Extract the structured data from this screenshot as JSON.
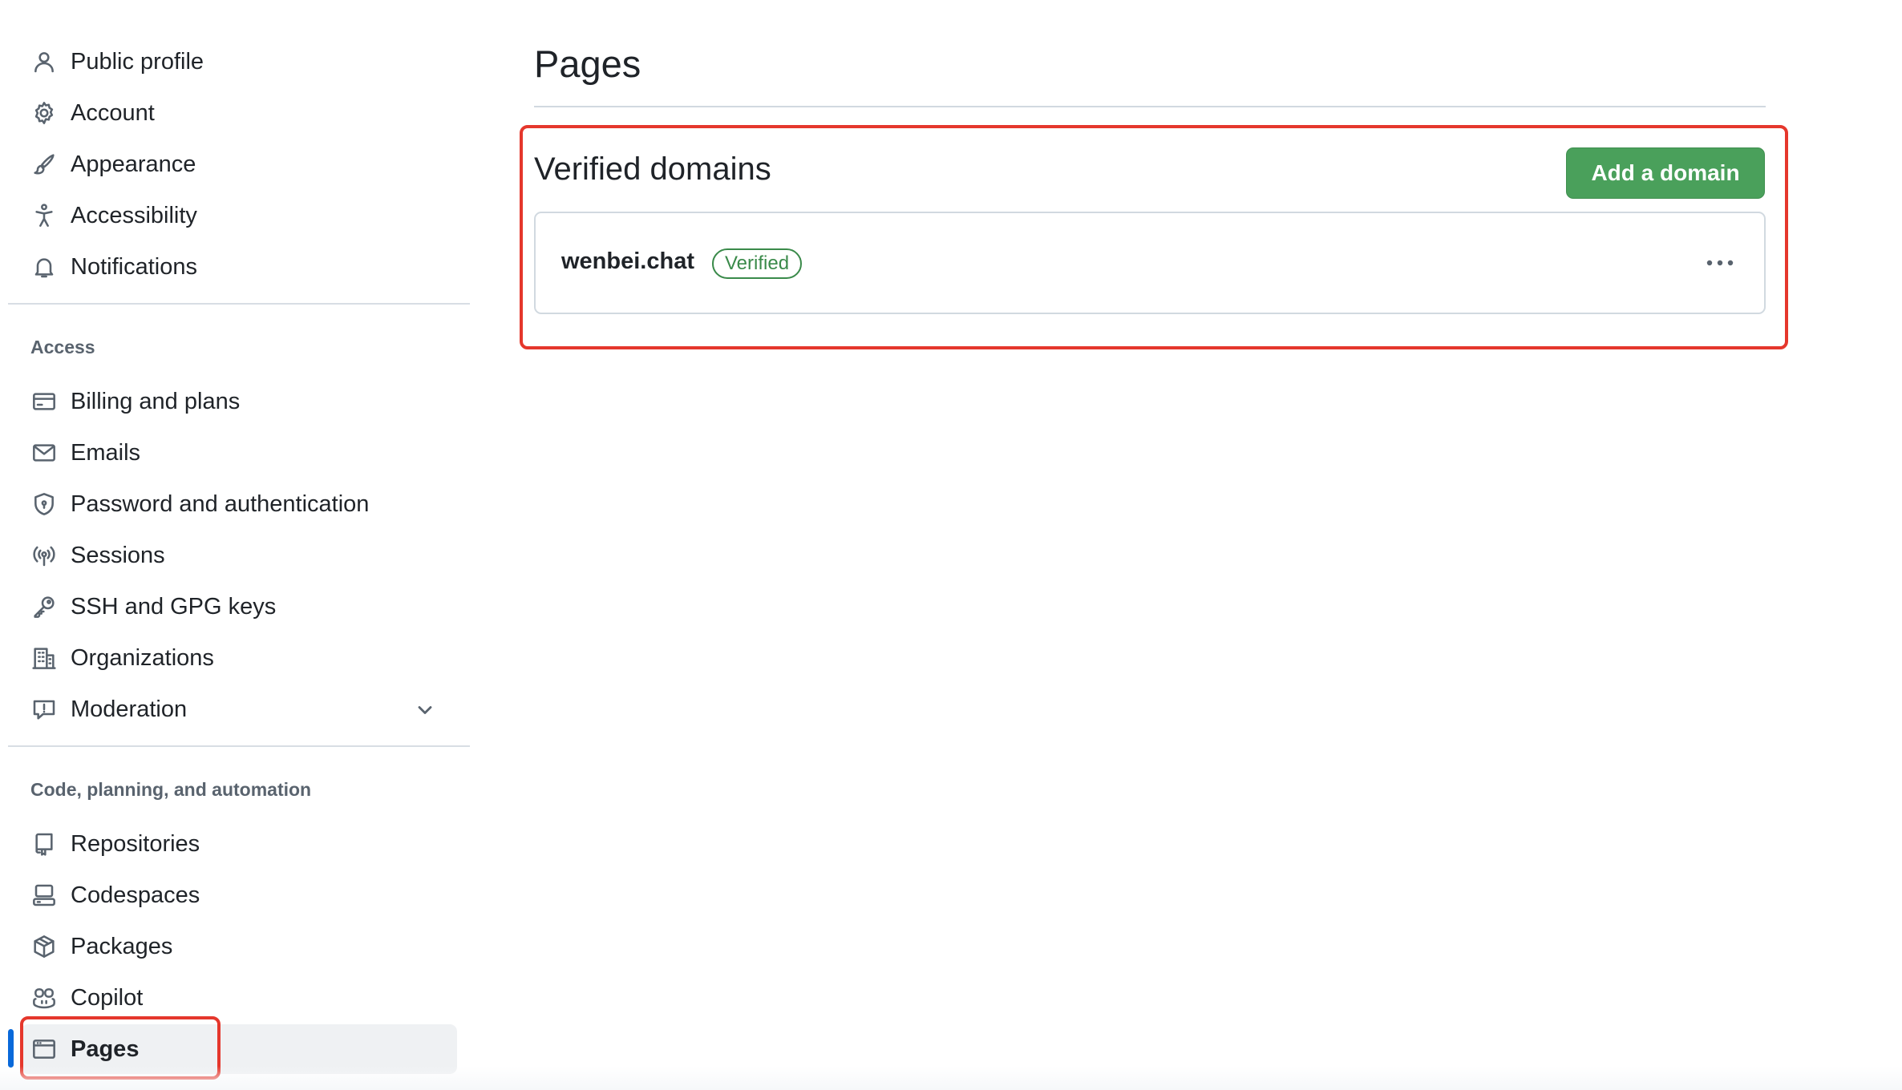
{
  "sidebar": {
    "top_items": [
      {
        "label": "Public profile",
        "icon": "person-icon"
      },
      {
        "label": "Account",
        "icon": "gear-icon"
      },
      {
        "label": "Appearance",
        "icon": "paintbrush-icon"
      },
      {
        "label": "Accessibility",
        "icon": "accessibility-icon"
      },
      {
        "label": "Notifications",
        "icon": "bell-icon"
      }
    ],
    "access_heading": "Access",
    "access_items": [
      {
        "label": "Billing and plans",
        "icon": "credit-card-icon"
      },
      {
        "label": "Emails",
        "icon": "mail-icon"
      },
      {
        "label": "Password and authentication",
        "icon": "shield-lock-icon"
      },
      {
        "label": "Sessions",
        "icon": "broadcast-icon"
      },
      {
        "label": "SSH and GPG keys",
        "icon": "key-icon"
      },
      {
        "label": "Organizations",
        "icon": "organization-icon"
      },
      {
        "label": "Moderation",
        "icon": "report-icon"
      }
    ],
    "code_heading": "Code, planning, and automation",
    "code_items": [
      {
        "label": "Repositories",
        "icon": "repo-icon"
      },
      {
        "label": "Codespaces",
        "icon": "codespaces-icon"
      },
      {
        "label": "Packages",
        "icon": "package-icon"
      },
      {
        "label": "Copilot",
        "icon": "copilot-icon"
      },
      {
        "label": "Pages",
        "icon": "browser-icon",
        "active": true
      }
    ],
    "accent_color": "#0969da"
  },
  "main": {
    "title": "Pages",
    "section_title": "Verified domains",
    "add_button_label": "Add a domain",
    "domains": [
      {
        "name": "wenbei.chat",
        "status": "Verified"
      }
    ],
    "button_color": "#4aa05b",
    "badge_color": "#3a8a4a"
  },
  "annotation_color": "#e5372c"
}
